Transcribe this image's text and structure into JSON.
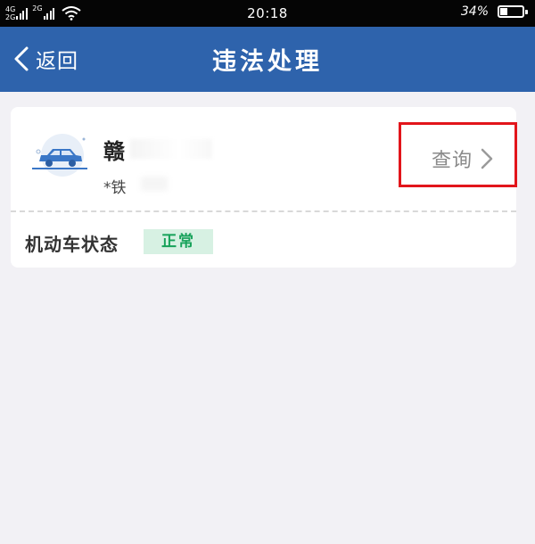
{
  "status_bar": {
    "network_top": "4G",
    "network_bottom": "2G",
    "network_mid": "2G",
    "time": "20:18",
    "battery_percent": "34%",
    "battery_level": 0.34,
    "wifi_icon": "wifi-icon"
  },
  "nav": {
    "back_label": "返回",
    "title": "违法处理",
    "back_icon": "chevron-left-icon"
  },
  "vehicle": {
    "plate": "赣",
    "owner": "*铁",
    "icon": "car-icon",
    "query_label": "查询",
    "query_icon": "chevron-right-icon"
  },
  "status": {
    "label": "机动车状态",
    "badge": "正常"
  },
  "colors": {
    "nav_blue": "#2e63ac",
    "badge_green": "#17a25a",
    "badge_bg": "#d7f1e3",
    "highlight_red": "#e2151b"
  }
}
